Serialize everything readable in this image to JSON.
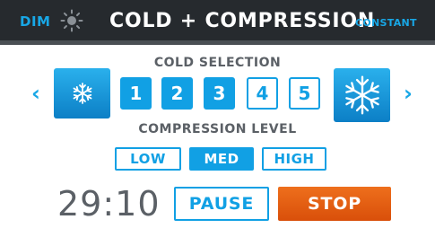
{
  "header": {
    "dim_label": "DIM",
    "title": "COLD + COMPRESSION",
    "mode_label": "CONSTANT",
    "accent_color": "#18a7e6",
    "background_color": "#262a2e"
  },
  "cold": {
    "section_label": "COLD SELECTION",
    "prev_symbol": "‹",
    "next_symbol": "›",
    "less_cold_icon": "snowflake-small-icon",
    "more_cold_icon": "snowflake-large-icon",
    "levels": [
      {
        "label": "1",
        "selected": true
      },
      {
        "label": "2",
        "selected": true
      },
      {
        "label": "3",
        "selected": true
      },
      {
        "label": "4",
        "selected": false
      },
      {
        "label": "5",
        "selected": false
      }
    ],
    "current_level": 3
  },
  "compression": {
    "section_label": "COMPRESSION LEVEL",
    "options": [
      {
        "label": "LOW",
        "selected": false
      },
      {
        "label": "MED",
        "selected": true
      },
      {
        "label": "HIGH",
        "selected": false
      }
    ]
  },
  "session": {
    "timer": "29:10",
    "pause_label": "PAUSE",
    "stop_label": "STOP",
    "stop_color": "#e45d12"
  }
}
